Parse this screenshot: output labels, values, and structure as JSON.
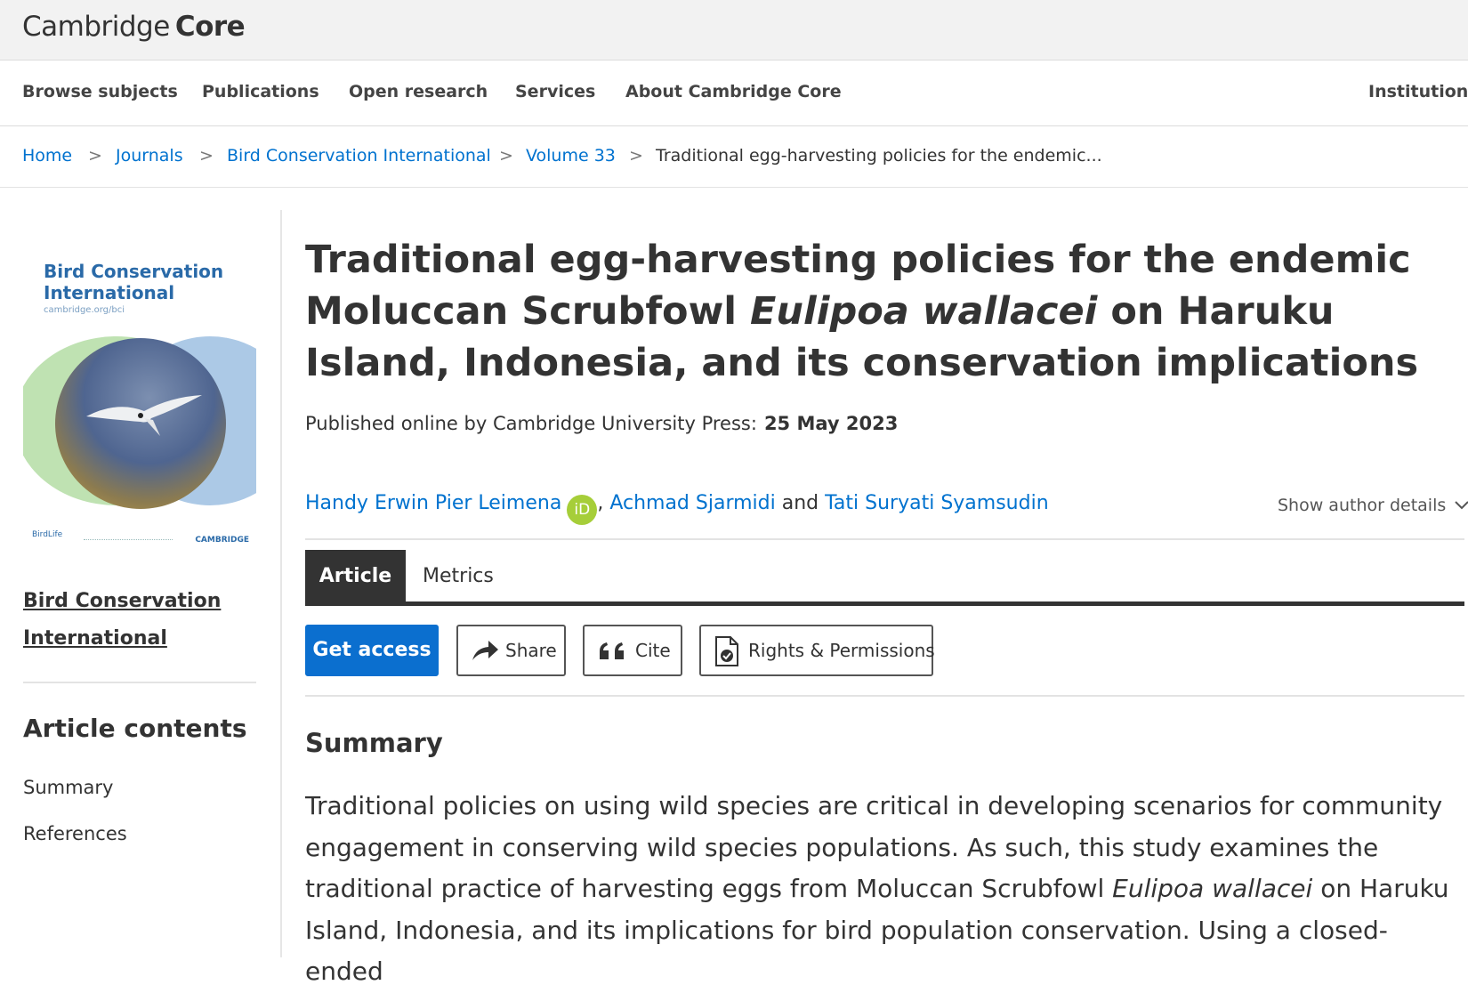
{
  "header": {
    "logo_part1": "Cambridge",
    "logo_part2": "Core"
  },
  "nav": {
    "items": [
      "Browse subjects",
      "Publications",
      "Open research",
      "Services",
      "About Cambridge Core"
    ],
    "institution": "Institution l"
  },
  "breadcrumb": {
    "home": "Home",
    "journals": "Journals",
    "journal": "Bird Conservation International",
    "volume": "Volume 33",
    "current": "Traditional egg-harvesting policies for the endemic...",
    "separator": ">"
  },
  "sidebar": {
    "cover": {
      "title_line1": "Bird Conservation",
      "title_line2": "International",
      "url": "cambridge.org/bci",
      "publisher_left": "BirdLife",
      "publisher_right": "CAMBRIDGE"
    },
    "journal_link_line1": "Bird Conservation",
    "journal_link_line2": "International",
    "contents_heading": "Article contents",
    "contents": [
      "Summary",
      "References"
    ]
  },
  "article": {
    "title_part1": "Traditional egg-harvesting policies for the endemic Moluccan Scrubfowl ",
    "title_species": "Eulipoa wallacei",
    "title_part2": " on Haruku Island, Indonesia, and its conservation implications",
    "published_label": "Published online by Cambridge University Press:",
    "published_date": "25 May 2023",
    "authors": [
      "Handy Erwin Pier Leimena",
      "Achmad Sjarmidi",
      "Tati Suryati Syamsudin"
    ],
    "author_sep_comma": ",",
    "author_sep_and": "and",
    "orcid": "iD",
    "show_author_details": "Show author details"
  },
  "tabs": {
    "article": "Article",
    "metrics": "Metrics"
  },
  "actions": {
    "get_access": "Get access",
    "share": "Share",
    "cite": "Cite",
    "rights": "Rights & Permissions"
  },
  "summary": {
    "heading": "Summary",
    "text_part1": "Traditional policies on using wild species are critical in developing scenarios for community engagement in conserving wild species populations. As such, this study examines the traditional practice of harvesting eggs from Moluccan Scrubfowl ",
    "text_species": "Eulipoa wallacei",
    "text_part2": " on Haruku Island, Indonesia, and its implications for bird population conservation. Using a closed-ended"
  }
}
